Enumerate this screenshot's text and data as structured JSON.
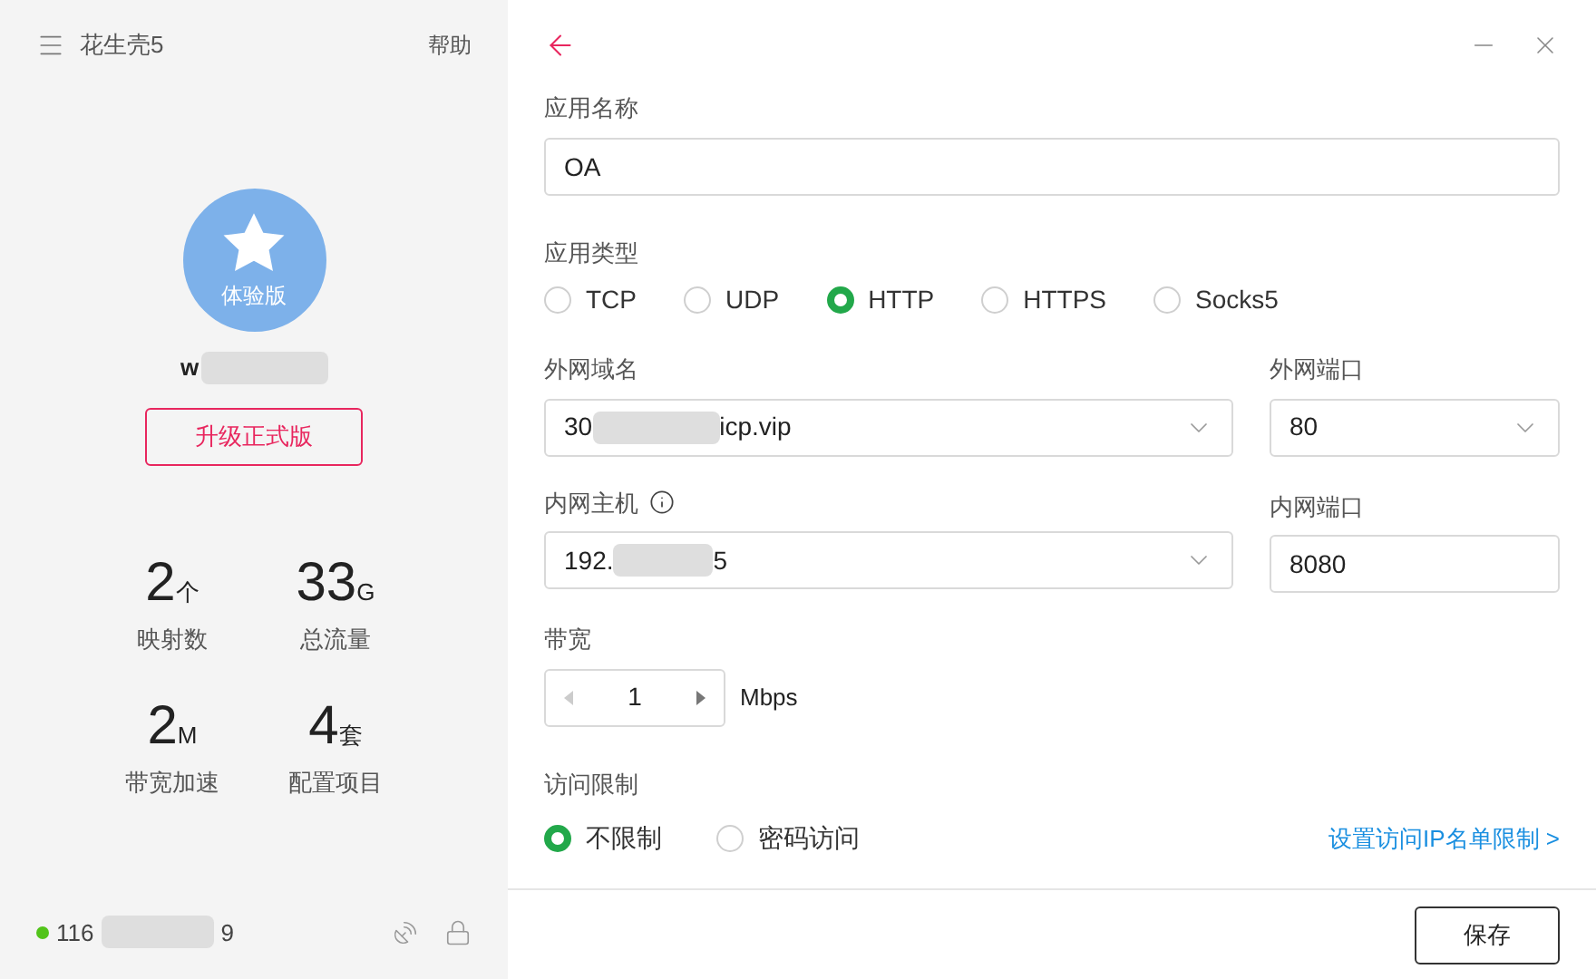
{
  "sidebar": {
    "title": "花生壳5",
    "help": "帮助",
    "avatar_badge": "体验版",
    "username_start": "w",
    "upgrade_button": "升级正式版",
    "stats": [
      {
        "value": "2",
        "unit": "个",
        "label": "映射数"
      },
      {
        "value": "33",
        "unit": "G",
        "label": "总流量"
      },
      {
        "value": "2",
        "unit": "M",
        "label": "带宽加速"
      },
      {
        "value": "4",
        "unit": "套",
        "label": "配置项目"
      }
    ],
    "status": {
      "online": true,
      "ip_start": "116",
      "ip_end": "9"
    }
  },
  "form": {
    "name_label": "应用名称",
    "name_value": "OA",
    "type_label": "应用类型",
    "types": [
      {
        "label": "TCP",
        "selected": false
      },
      {
        "label": "UDP",
        "selected": false
      },
      {
        "label": "HTTP",
        "selected": true
      },
      {
        "label": "HTTPS",
        "selected": false
      },
      {
        "label": "Socks5",
        "selected": false
      }
    ],
    "domain": {
      "label": "外网域名",
      "value_start": "30",
      "value_end": "icp.vip"
    },
    "external_port": {
      "label": "外网端口",
      "value": "80"
    },
    "host": {
      "label": "内网主机",
      "value_start": "192.",
      "value_end": "5"
    },
    "internal_port": {
      "label": "内网端口",
      "value": "8080"
    },
    "bandwidth": {
      "label": "带宽",
      "value": "1",
      "unit": "Mbps"
    },
    "access_label": "访问限制",
    "access": [
      {
        "label": "不限制",
        "selected": true
      },
      {
        "label": "密码访问",
        "selected": false
      }
    ],
    "ip_list_link": "设置访问IP名单限制 >",
    "save": "保存"
  }
}
